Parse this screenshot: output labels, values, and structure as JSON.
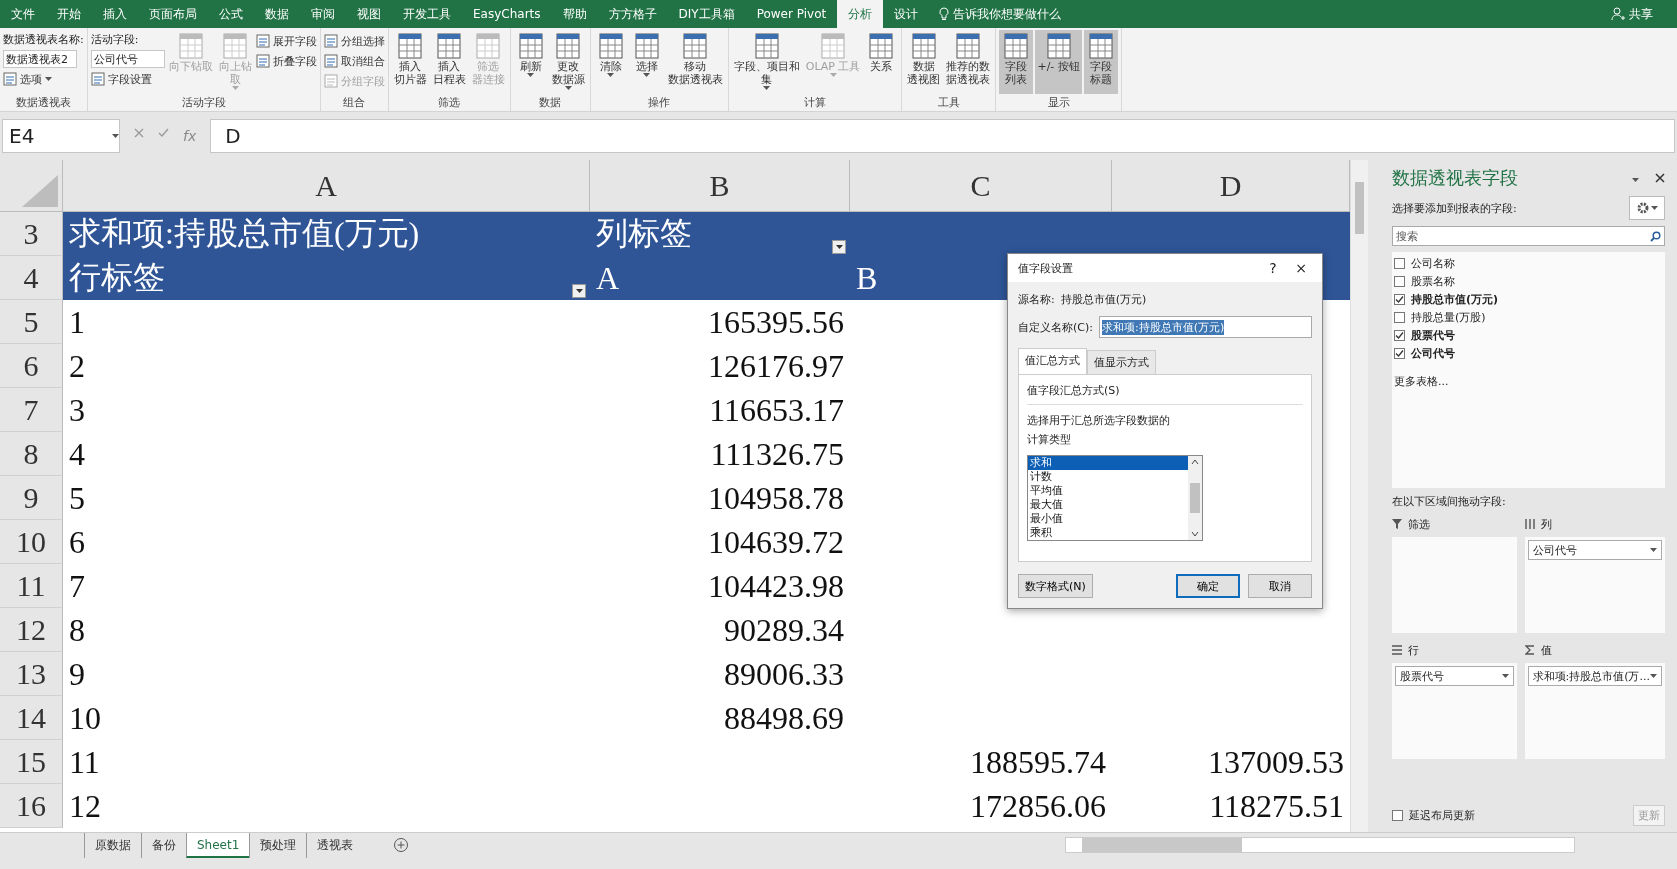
{
  "ribbon_tabs": [
    {
      "label": "文件",
      "selected": false
    },
    {
      "label": "开始",
      "selected": false
    },
    {
      "label": "插入",
      "selected": false
    },
    {
      "label": "页面布局",
      "selected": false
    },
    {
      "label": "公式",
      "selected": false
    },
    {
      "label": "数据",
      "selected": false
    },
    {
      "label": "审阅",
      "selected": false
    },
    {
      "label": "视图",
      "selected": false
    },
    {
      "label": "开发工具",
      "selected": false
    },
    {
      "label": "EasyCharts",
      "selected": false
    },
    {
      "label": "帮助",
      "selected": false
    },
    {
      "label": "方方格子",
      "selected": false
    },
    {
      "label": "DIY工具箱",
      "selected": false
    },
    {
      "label": "Power Pivot",
      "selected": false
    },
    {
      "label": "分析",
      "selected": true
    },
    {
      "label": "设计",
      "selected": false
    }
  ],
  "tell_me": "告诉我你想要做什么",
  "share": "共享",
  "ribbon_groups": [
    {
      "label": "数据透视表",
      "items": [
        {
          "kind": "field",
          "label": "数据透视表名称:",
          "value": "数据透视表2"
        },
        {
          "kind": "small",
          "label": "选项",
          "disabled": false,
          "dropdown": true
        }
      ]
    },
    {
      "label": "活动字段",
      "items": [
        {
          "kind": "field",
          "label": "活动字段:",
          "value": "公司代号"
        },
        {
          "kind": "small",
          "label": "字段设置",
          "disabled": false,
          "dropdown": false
        },
        {
          "kind": "large",
          "lines": [
            "向下钻取"
          ],
          "disabled": true,
          "dropdown": false
        },
        {
          "kind": "large",
          "lines": [
            "向上钻",
            "取"
          ],
          "disabled": true,
          "dropdown": true
        },
        {
          "kind": "small",
          "label": "展开字段",
          "disabled": false,
          "dropdown": false
        },
        {
          "kind": "small",
          "label": "折叠字段",
          "disabled": false,
          "dropdown": false
        }
      ]
    },
    {
      "label": "组合",
      "items": [
        {
          "kind": "small",
          "label": "分组选择",
          "disabled": false,
          "dropdown": false
        },
        {
          "kind": "small",
          "label": "取消组合",
          "disabled": false,
          "dropdown": false
        },
        {
          "kind": "small",
          "label": "分组字段",
          "disabled": true,
          "dropdown": false
        }
      ]
    },
    {
      "label": "筛选",
      "items": [
        {
          "kind": "large",
          "lines": [
            "插入",
            "切片器"
          ],
          "disabled": false,
          "dropdown": false
        },
        {
          "kind": "large",
          "lines": [
            "插入",
            "日程表"
          ],
          "disabled": false,
          "dropdown": false
        },
        {
          "kind": "large",
          "lines": [
            "筛选",
            "器连接"
          ],
          "disabled": true,
          "dropdown": false
        }
      ]
    },
    {
      "label": "数据",
      "items": [
        {
          "kind": "large",
          "lines": [
            "刷新"
          ],
          "disabled": false,
          "dropdown": true
        },
        {
          "kind": "large",
          "lines": [
            "更改",
            "数据源"
          ],
          "disabled": false,
          "dropdown": true
        }
      ]
    },
    {
      "label": "操作",
      "items": [
        {
          "kind": "large",
          "lines": [
            "清除"
          ],
          "disabled": false,
          "dropdown": true
        },
        {
          "kind": "large",
          "lines": [
            "选择"
          ],
          "disabled": false,
          "dropdown": true
        },
        {
          "kind": "large",
          "lines": [
            "移动",
            "数据透视表"
          ],
          "disabled": false,
          "dropdown": false
        }
      ]
    },
    {
      "label": "计算",
      "items": [
        {
          "kind": "large",
          "lines": [
            "字段、项目和",
            "集"
          ],
          "disabled": false,
          "dropdown": true
        },
        {
          "kind": "large",
          "lines": [
            "OLAP 工具"
          ],
          "disabled": true,
          "dropdown": true
        },
        {
          "kind": "large",
          "lines": [
            "关系"
          ],
          "disabled": false,
          "dropdown": false
        }
      ]
    },
    {
      "label": "工具",
      "items": [
        {
          "kind": "large",
          "lines": [
            "数据",
            "透视图"
          ],
          "disabled": false,
          "dropdown": false
        },
        {
          "kind": "large",
          "lines": [
            "推荐的数",
            "据透视表"
          ],
          "disabled": false,
          "dropdown": false
        }
      ]
    },
    {
      "label": "显示",
      "items": [
        {
          "kind": "large",
          "lines": [
            "字段",
            "列表"
          ],
          "disabled": false,
          "dropdown": false,
          "selected": true
        },
        {
          "kind": "large",
          "lines": [
            "+/- 按钮"
          ],
          "disabled": false,
          "dropdown": false,
          "selected": true
        },
        {
          "kind": "large",
          "lines": [
            "字段",
            "标题"
          ],
          "disabled": false,
          "dropdown": false,
          "selected": true
        }
      ]
    }
  ],
  "name_box": "E4",
  "fx": "fx",
  "formula": "D",
  "columns": [
    "A",
    "B",
    "C",
    "D"
  ],
  "rows": [
    {
      "number": "3",
      "kind": "header",
      "a": {
        "text": "求和项:持股总市值(万元)",
        "filter": false
      },
      "b": {
        "text": "列标签",
        "filter": true
      }
    },
    {
      "number": "4",
      "kind": "header",
      "a": {
        "text": "行标签",
        "filter": true
      },
      "b": {
        "text": "A",
        "filter": false
      },
      "c": {
        "text": "B"
      }
    },
    {
      "number": "5",
      "kind": "data",
      "a": {
        "text": "1"
      },
      "b": {
        "text": "165395.56"
      }
    },
    {
      "number": "6",
      "kind": "data",
      "a": {
        "text": "2"
      },
      "b": {
        "text": "126176.97"
      }
    },
    {
      "number": "7",
      "kind": "data",
      "a": {
        "text": "3"
      },
      "b": {
        "text": "116653.17"
      }
    },
    {
      "number": "8",
      "kind": "data",
      "a": {
        "text": "4"
      },
      "b": {
        "text": "111326.75"
      }
    },
    {
      "number": "9",
      "kind": "data",
      "a": {
        "text": "5"
      },
      "b": {
        "text": "104958.78"
      }
    },
    {
      "number": "10",
      "kind": "data",
      "a": {
        "text": "6"
      },
      "b": {
        "text": "104639.72"
      }
    },
    {
      "number": "11",
      "kind": "data",
      "a": {
        "text": "7"
      },
      "b": {
        "text": "104423.98"
      }
    },
    {
      "number": "12",
      "kind": "data",
      "a": {
        "text": "8"
      },
      "b": {
        "text": "90289.34"
      }
    },
    {
      "number": "13",
      "kind": "data",
      "a": {
        "text": "9"
      },
      "b": {
        "text": "89006.33"
      }
    },
    {
      "number": "14",
      "kind": "data",
      "a": {
        "text": "10"
      },
      "b": {
        "text": "88498.69"
      }
    },
    {
      "number": "15",
      "kind": "data",
      "a": {
        "text": "11"
      },
      "c": {
        "text": "188595.74"
      },
      "d": {
        "text": "137009.53"
      }
    },
    {
      "number": "16",
      "kind": "data",
      "a": {
        "text": "12"
      },
      "c": {
        "text": "172856.06"
      },
      "d": {
        "text": "118275.51"
      }
    }
  ],
  "sheet_tabs": [
    {
      "label": "原数据",
      "selected": false
    },
    {
      "label": "备份",
      "selected": false
    },
    {
      "label": "Sheet1",
      "selected": true
    },
    {
      "label": "预处理",
      "selected": false
    },
    {
      "label": "透视表",
      "selected": false
    }
  ],
  "dialog": {
    "title": "值字段设置",
    "help": "?",
    "close": "×",
    "source_label": "源名称:",
    "source_value": "持股总市值(万元)",
    "custom_label": "自定义名称(C):",
    "custom_value": "求和项:持股总市值(万元)",
    "tabs": [
      {
        "label": "值汇总方式",
        "selected": true
      },
      {
        "label": "值显示方式",
        "selected": false
      }
    ],
    "section": "值字段汇总方式(S)",
    "description": "选择用于汇总所选字段数据的",
    "type_label": "计算类型",
    "options": [
      {
        "label": "求和",
        "selected": true
      },
      {
        "label": "计数",
        "selected": false
      },
      {
        "label": "平均值",
        "selected": false
      },
      {
        "label": "最大值",
        "selected": false
      },
      {
        "label": "最小值",
        "selected": false
      },
      {
        "label": "乘积",
        "selected": false
      }
    ],
    "buttons": [
      {
        "label": "数字格式(N)",
        "kind": "secondary"
      },
      {
        "label": "确定",
        "kind": "default"
      },
      {
        "label": "取消",
        "kind": "normal"
      }
    ]
  },
  "field_pane": {
    "title": "数据透视表字段",
    "subtitle": "选择要添加到报表的字段:",
    "search_placeholder": "搜索",
    "fields": [
      {
        "label": "公司名称",
        "checked": false
      },
      {
        "label": "股票名称",
        "checked": false
      },
      {
        "label": "持股总市值(万元)",
        "checked": true
      },
      {
        "label": "持股总量(万股)",
        "checked": false
      },
      {
        "label": "股票代号",
        "checked": true
      },
      {
        "label": "公司代号",
        "checked": true
      }
    ],
    "more_tables": "更多表格...",
    "areas_hint": "在以下区域间拖动字段:",
    "areas": [
      {
        "kind": "filter",
        "label": "筛选"
      },
      {
        "kind": "columns",
        "label": "列",
        "items": [
          "公司代号"
        ]
      },
      {
        "kind": "rows",
        "label": "行",
        "items": [
          "股票代号"
        ]
      },
      {
        "kind": "values",
        "label": "值",
        "items": [
          "求和项:持股总市值(万..."
        ]
      }
    ],
    "defer_label": "延迟布局更新",
    "defer_checked": false,
    "update": "更新"
  }
}
